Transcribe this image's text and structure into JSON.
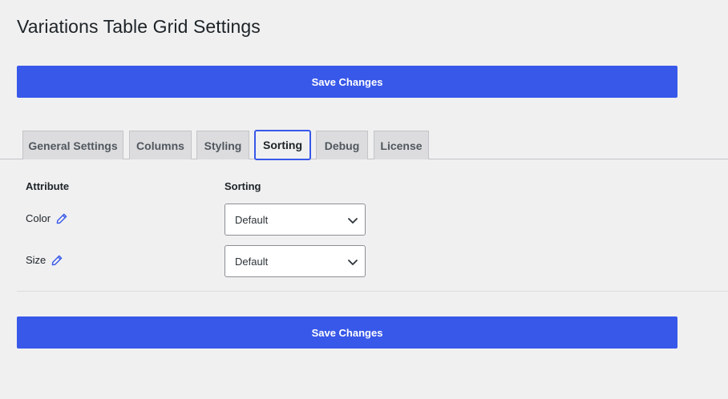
{
  "page": {
    "title": "Variations Table Grid Settings"
  },
  "buttons": {
    "save_label": "Save Changes"
  },
  "tabs": [
    {
      "label": "General Settings",
      "active": false
    },
    {
      "label": "Columns",
      "active": false
    },
    {
      "label": "Styling",
      "active": false
    },
    {
      "label": "Sorting",
      "active": true
    },
    {
      "label": "Debug",
      "active": false
    },
    {
      "label": "License",
      "active": false
    }
  ],
  "sorting_table": {
    "headers": {
      "attribute": "Attribute",
      "sorting": "Sorting"
    },
    "rows": [
      {
        "attribute": "Color",
        "icon": "pencil-icon",
        "sorting_value": "Default"
      },
      {
        "attribute": "Size",
        "icon": "pencil-icon",
        "sorting_value": "Default"
      }
    ]
  },
  "colors": {
    "accent": "#3858e9",
    "background": "#f0f0f1",
    "tab_inactive": "#dcdcde"
  }
}
